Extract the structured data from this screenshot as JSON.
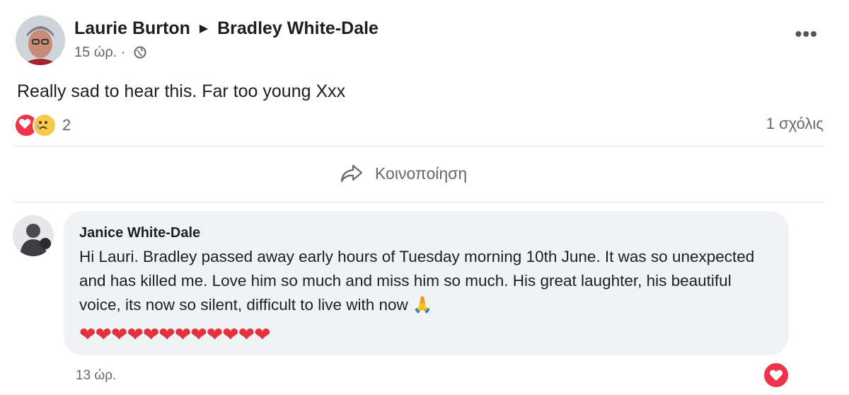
{
  "post": {
    "author": "Laurie Burton",
    "recipient": "Bradley White-Dale",
    "time": "15 ώρ.",
    "time_separator": "·",
    "text": "Really sad to hear this. Far too young Xxx",
    "reaction_count": "2",
    "comment_count": "1 σχόλις",
    "share_label": "Κοινοποίηση",
    "more_label": "•••"
  },
  "comment": {
    "author": "Janice White-Dale",
    "text": "Hi Lauri. Bradley passed away early hours of Tuesday morning 10th June. It was so unexpected and has killed me. Love him so much and miss him so much. His great laughter, his beautiful voice, its now so silent, difficult to live with now",
    "emoji_end": "🙏",
    "hearts": "❤❤❤❤❤❤❤❤❤❤❤❤",
    "time": "13 ώρ."
  },
  "icons": {
    "reaction_1": "love-reaction-icon",
    "reaction_2": "sad-reaction-icon",
    "share": "share-arrow-icon",
    "globe": "globe-icon",
    "more": "more-options-icon"
  },
  "colors": {
    "love": "#f0334a",
    "sad": "#f7c84b",
    "bubble": "#f0f2f5",
    "secondary_text": "#65676b"
  }
}
